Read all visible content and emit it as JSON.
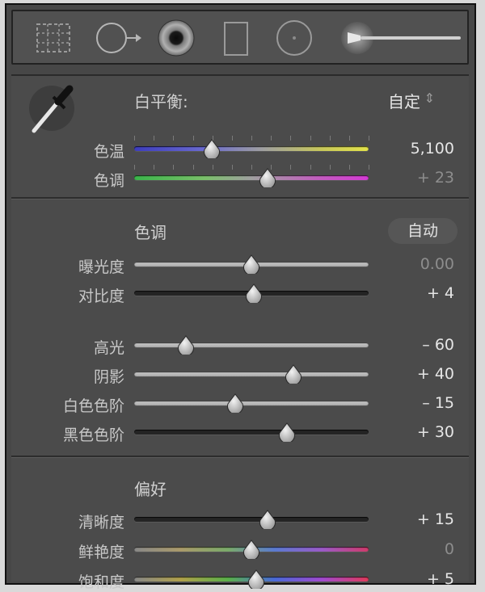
{
  "wb_section": {
    "title": "白平衡:",
    "preset": "自定",
    "preset_arrows": "⇕",
    "sliders": [
      {
        "label": "色温",
        "value": "5,100",
        "level": 0.33,
        "dim": false,
        "track": "temp"
      },
      {
        "label": "色调",
        "value": "+ 23",
        "level": 0.57,
        "dim": true,
        "track": "tint"
      }
    ]
  },
  "tone_section": {
    "title": "色调",
    "auto_label": "自动",
    "sliders": [
      {
        "label": "曝光度",
        "value": "0.00",
        "level": 0.5,
        "dim": true,
        "track": "light"
      },
      {
        "label": "对比度",
        "value": "+ 4",
        "level": 0.51,
        "dim": false,
        "track": "dark"
      },
      {
        "label": "高光",
        "value": "– 60",
        "level": 0.22,
        "dim": false,
        "track": "light"
      },
      {
        "label": "阴影",
        "value": "+ 40",
        "level": 0.68,
        "dim": false,
        "track": "light"
      },
      {
        "label": "白色色阶",
        "value": "– 15",
        "level": 0.43,
        "dim": false,
        "track": "light"
      },
      {
        "label": "黑色色阶",
        "value": "+ 30",
        "level": 0.65,
        "dim": false,
        "track": "dark"
      }
    ]
  },
  "presence_section": {
    "title": "偏好",
    "sliders": [
      {
        "label": "清晰度",
        "value": "+ 15",
        "level": 0.57,
        "dim": false,
        "track": "dark"
      },
      {
        "label": "鲜艳度",
        "value": "0",
        "level": 0.5,
        "dim": true,
        "track": "vib"
      },
      {
        "label": "饱和度",
        "value": "+ 5",
        "level": 0.52,
        "dim": false,
        "track": "sat"
      }
    ]
  },
  "toolbar": {
    "tools": [
      "crop-overlay-icon",
      "spot-removal-icon",
      "red-eye-icon",
      "graduated-filter-icon",
      "radial-filter-icon",
      "adjustment-brush-icon"
    ]
  }
}
